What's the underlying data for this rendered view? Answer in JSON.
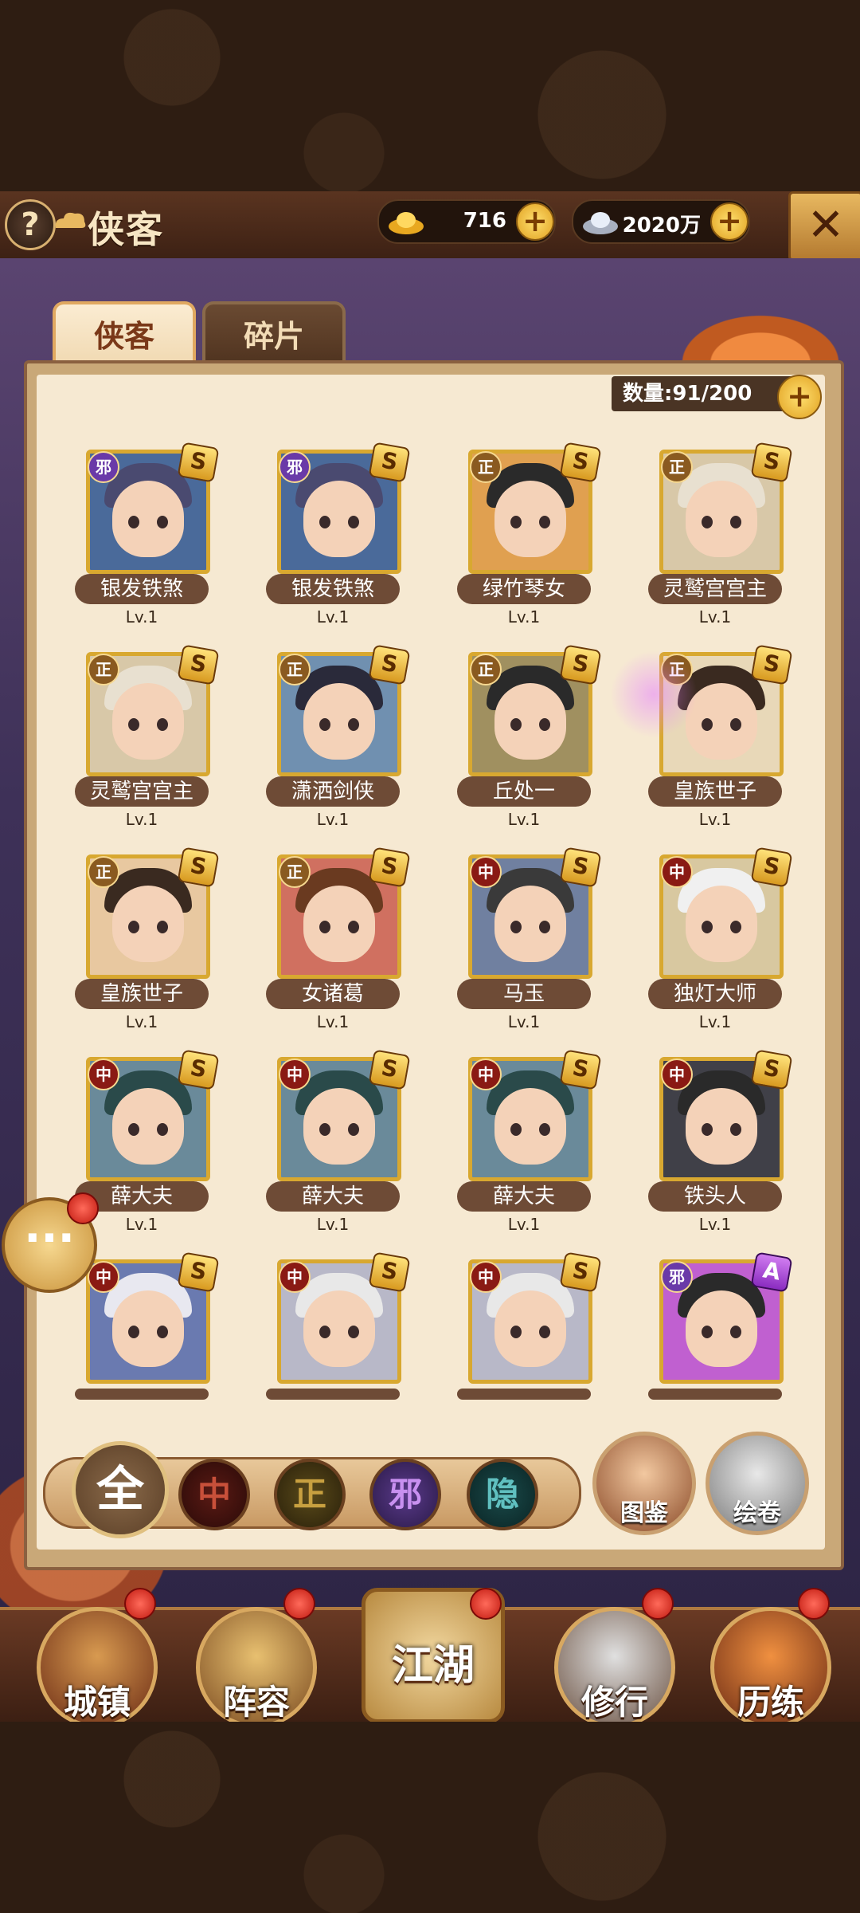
{
  "header": {
    "title": "侠客",
    "help": "?",
    "close": "✕"
  },
  "currency": {
    "gold": "716",
    "silver": "2020万"
  },
  "tabs": [
    {
      "label": "侠客"
    },
    {
      "label": "碎片"
    }
  ],
  "count": "数量:91/200",
  "heroes": [
    {
      "name": "银发铁煞",
      "level": "Lv.1",
      "faction": "邪",
      "grade": "S"
    },
    {
      "name": "银发铁煞",
      "level": "Lv.1",
      "faction": "邪",
      "grade": "S"
    },
    {
      "name": "绿竹琴女",
      "level": "Lv.1",
      "faction": "正",
      "grade": "S"
    },
    {
      "name": "灵鹫宫宫主",
      "level": "Lv.1",
      "faction": "正",
      "grade": "S"
    },
    {
      "name": "灵鹫宫宫主",
      "level": "Lv.1",
      "faction": "正",
      "grade": "S"
    },
    {
      "name": "潇洒剑侠",
      "level": "Lv.1",
      "faction": "正",
      "grade": "S"
    },
    {
      "name": "丘处一",
      "level": "Lv.1",
      "faction": "正",
      "grade": "S"
    },
    {
      "name": "皇族世子",
      "level": "Lv.1",
      "faction": "正",
      "grade": "S"
    },
    {
      "name": "皇族世子",
      "level": "Lv.1",
      "faction": "正",
      "grade": "S"
    },
    {
      "name": "女诸葛",
      "level": "Lv.1",
      "faction": "正",
      "grade": "S"
    },
    {
      "name": "马玉",
      "level": "Lv.1",
      "faction": "中",
      "grade": "S"
    },
    {
      "name": "独灯大师",
      "level": "Lv.1",
      "faction": "中",
      "grade": "S"
    },
    {
      "name": "薛大夫",
      "level": "Lv.1",
      "faction": "中",
      "grade": "S"
    },
    {
      "name": "薛大夫",
      "level": "Lv.1",
      "faction": "中",
      "grade": "S"
    },
    {
      "name": "薛大夫",
      "level": "Lv.1",
      "faction": "中",
      "grade": "S"
    },
    {
      "name": "铁头人",
      "level": "Lv.1",
      "faction": "中",
      "grade": "S"
    },
    {
      "name": "",
      "level": "",
      "faction": "中",
      "grade": "S"
    },
    {
      "name": "",
      "level": "",
      "faction": "中",
      "grade": "S"
    },
    {
      "name": "",
      "level": "",
      "faction": "中",
      "grade": "S"
    },
    {
      "name": "",
      "level": "",
      "faction": "邪",
      "grade": "A"
    }
  ],
  "filters": {
    "all": "全",
    "neutral": "中",
    "righteous": "正",
    "evil": "邪",
    "hidden": "隐"
  },
  "side_buttons": {
    "codex": "图鉴",
    "scroll": "绘卷"
  },
  "nav": {
    "town": "城镇",
    "lineup": "阵容",
    "jianghu": "江湖",
    "training": "修行",
    "trial": "历练"
  },
  "colors": {
    "gold": "#d8a830",
    "panel": "#f6e9d2",
    "header": "#4a2a18",
    "evil": "#6a3aa8",
    "righteous": "#8a5a20",
    "neutral": "#8a1a14"
  }
}
